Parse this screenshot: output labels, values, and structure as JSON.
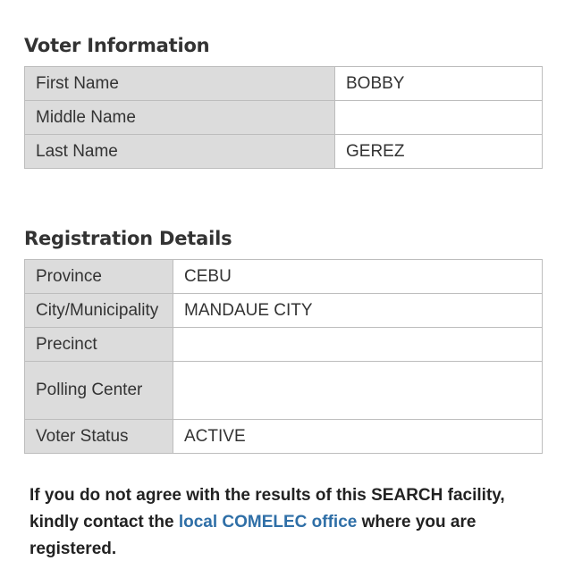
{
  "voter_info": {
    "title": "Voter Information",
    "rows": [
      {
        "label": "First Name",
        "value": "BOBBY"
      },
      {
        "label": "Middle Name",
        "value": ""
      },
      {
        "label": "Last Name",
        "value": "GEREZ"
      }
    ]
  },
  "registration": {
    "title": "Registration Details",
    "rows": [
      {
        "label": "Province",
        "value": "CEBU"
      },
      {
        "label": "City/Municipality",
        "value": "MANDAUE CITY"
      },
      {
        "label": "Precinct",
        "value": ""
      },
      {
        "label": "Polling Center",
        "value": ""
      },
      {
        "label": "Voter Status",
        "value": "ACTIVE"
      }
    ]
  },
  "notice": {
    "text_before": "If you do not agree with the results of this SEARCH facility, kindly contact the ",
    "link_text": "local COMELEC office",
    "text_after": " where you are registered."
  },
  "colors": {
    "label_bg": "#dcdcdc",
    "border": "#bdbdbd",
    "link": "#2f6fa7"
  }
}
